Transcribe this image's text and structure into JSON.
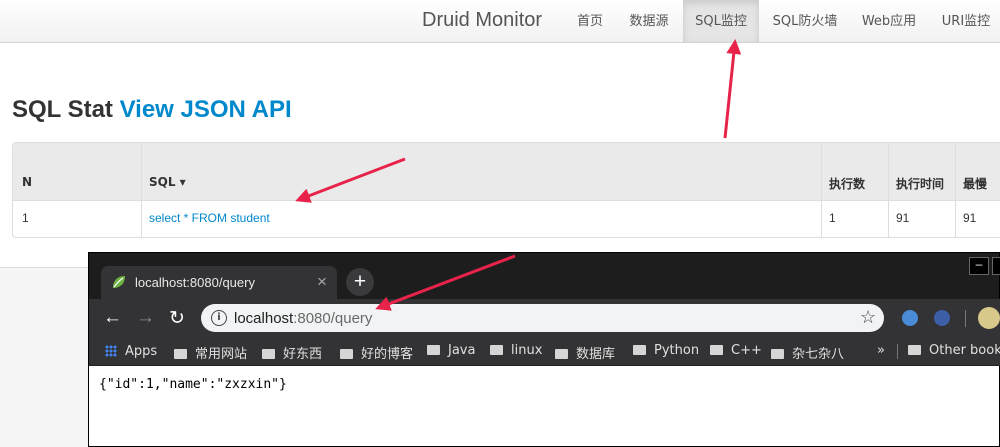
{
  "navbar": {
    "brand": "Druid Monitor",
    "items": [
      "首页",
      "数据源",
      "SQL监控",
      "SQL防火墙",
      "Web应用",
      "URI监控"
    ],
    "active_index": 2
  },
  "page": {
    "title": "SQL Stat",
    "api_link": "View JSON API"
  },
  "table": {
    "headers": [
      "N",
      "SQL ▾",
      "执行数",
      "执行时间",
      "最慢"
    ],
    "rows": [
      [
        "1",
        "select * FROM student",
        "1",
        "91",
        "91"
      ]
    ]
  },
  "browser": {
    "tab_title": "localhost:8080/query",
    "new_tab": "+",
    "url_host": "localhost",
    "url_path": ":8080/query",
    "bookmarks": [
      "Apps",
      "常用网站",
      "好东西",
      "好的博客",
      "Java",
      "linux",
      "数据库",
      "Python",
      "C++",
      "杂七杂八"
    ],
    "overflow": "»",
    "other_bookmarks": "Other bookm",
    "page_content": "{\"id\":1,\"name\":\"zxzxin\"}"
  },
  "colors": {
    "link": "#0088cc",
    "annotation_arrow": "#e8234a"
  }
}
